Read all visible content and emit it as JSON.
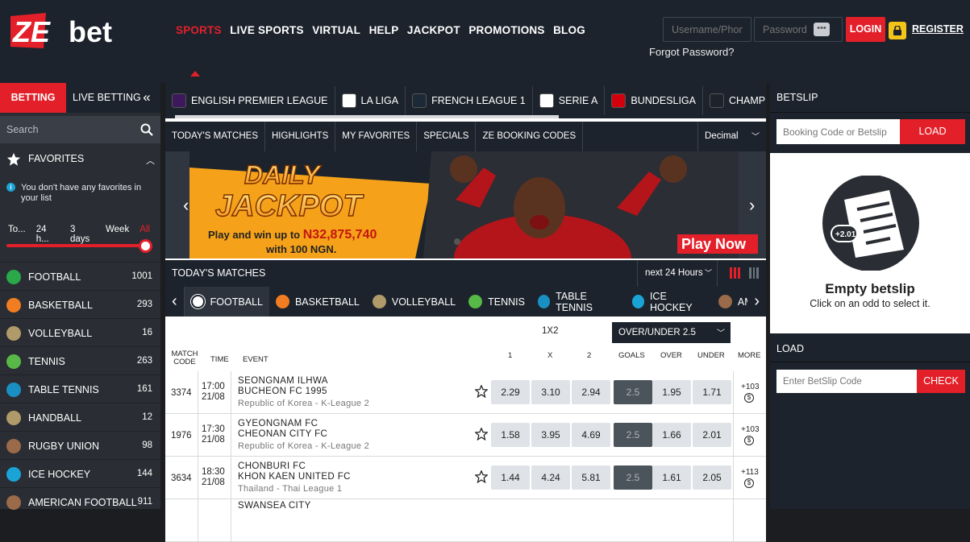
{
  "header": {
    "logo_text_ze": "ZE",
    "logo_text_bet": "bet",
    "nav": [
      "SPORTS",
      "LIVE SPORTS",
      "VIRTUAL",
      "HELP",
      "JACKPOT",
      "PROMOTIONS",
      "BLOG"
    ],
    "username_placeholder": "Username/Phone",
    "password_placeholder": "Password",
    "login": "LOGIN",
    "register": "REGISTER",
    "forgot": "Forgot Password?"
  },
  "sidebar": {
    "tab_betting": "BETTING",
    "tab_live": "LIVE BETTING",
    "collapse": "«",
    "search_placeholder": "Search",
    "favorites": "FAVORITES",
    "fav_note": "You don't have any favorites in your list",
    "timeframes": [
      "To...",
      "24 h...",
      "3 days",
      "Week",
      "All"
    ],
    "sports": [
      {
        "name": "FOOTBALL",
        "count": "1001",
        "color": "#2aa84a"
      },
      {
        "name": "BASKETBALL",
        "count": "293",
        "color": "#f07d22"
      },
      {
        "name": "VOLLEYBALL",
        "count": "16",
        "color": "#b09a6a"
      },
      {
        "name": "TENNIS",
        "count": "263",
        "color": "#58b847"
      },
      {
        "name": "TABLE TENNIS",
        "count": "161",
        "color": "#1a8fc2"
      },
      {
        "name": "HANDBALL",
        "count": "12",
        "color": "#b09a6a"
      },
      {
        "name": "RUGBY UNION",
        "count": "98",
        "color": "#9a6a4a"
      },
      {
        "name": "ICE HOCKEY",
        "count": "144",
        "color": "#1aa4d6"
      },
      {
        "name": "AMERICAN FOOTBALL",
        "count": "911",
        "color": "#9a6a4a"
      }
    ]
  },
  "leagues": [
    {
      "name": "ENGLISH PREMIER LEAGUE",
      "color": "#3d185c"
    },
    {
      "name": "LA LIGA",
      "color": "#ffffff"
    },
    {
      "name": "FRENCH LEAGUE 1",
      "color": "#1b2a36"
    },
    {
      "name": "SERIE A",
      "color": "#ffffff"
    },
    {
      "name": "BUNDESLIGA",
      "color": "#d3010c"
    },
    {
      "name": "CHAMPIONS LEA",
      "color": "#1c232c"
    }
  ],
  "subnav": [
    "TODAY'S MATCHES",
    "HIGHLIGHTS",
    "MY FAVORITES",
    "SPECIALS",
    "ZE BOOKING CODES"
  ],
  "odds_format": "Decimal",
  "banner": {
    "line1": "DAILY",
    "line2": "JACKPOT",
    "sub1": "Play and win up to ",
    "amount": "N32,875,740",
    "sub2": "with 100 NGN.",
    "cta": "Play Now"
  },
  "todays": {
    "title": "TODAY'S MATCHES",
    "range": "next 24 Hours"
  },
  "sport_tabs": [
    "FOOTBALL",
    "BASKETBALL",
    "VOLLEYBALL",
    "TENNIS",
    "TABLE TENNIS",
    "ICE HOCKEY",
    "AME"
  ],
  "table": {
    "market1": "1X2",
    "market2": "OVER/UNDER 2.5",
    "cols": {
      "code": "MATCH CODE",
      "time": "TIME",
      "event": "EVENT",
      "c1": "1",
      "cx": "X",
      "c2": "2",
      "goals": "GOALS",
      "over": "OVER",
      "under": "UNDER",
      "more": "MORE"
    },
    "rows": [
      {
        "code": "3374",
        "time": "17:00",
        "date": "21/08",
        "home": "SEONGNAM ILHWA",
        "away": "BUCHEON FC 1995",
        "league": "Republic of Korea - K-League 2",
        "o1": "2.29",
        "ox": "3.10",
        "o2": "2.94",
        "g": "2.5",
        "ov": "1.95",
        "un": "1.71",
        "more": "+103"
      },
      {
        "code": "1976",
        "time": "17:30",
        "date": "21/08",
        "home": "GYEONGNAM FC",
        "away": "CHEONAN CITY FC",
        "league": "Republic of Korea - K-League 2",
        "o1": "1.58",
        "ox": "3.95",
        "o2": "4.69",
        "g": "2.5",
        "ov": "1.66",
        "un": "2.01",
        "more": "+103"
      },
      {
        "code": "3634",
        "time": "18:30",
        "date": "21/08",
        "home": "CHONBURI FC",
        "away": "KHON KAEN UNITED FC",
        "league": "Thailand - Thai League 1",
        "o1": "1.44",
        "ox": "4.24",
        "o2": "5.81",
        "g": "2.5",
        "ov": "1.61",
        "un": "2.05",
        "more": "+113"
      },
      {
        "home": "SWANSEA CITY"
      }
    ]
  },
  "betslip": {
    "title": "BETSLIP",
    "code_placeholder": "Booking Code or Betslip",
    "load": "LOAD",
    "empty_title": "Empty betslip",
    "empty_sub": "Click on an odd to select it.",
    "load2": "LOAD",
    "enter_placeholder": "Enter BetSlip Code",
    "check": "CHECK",
    "ticket_badge": "+2.01"
  }
}
